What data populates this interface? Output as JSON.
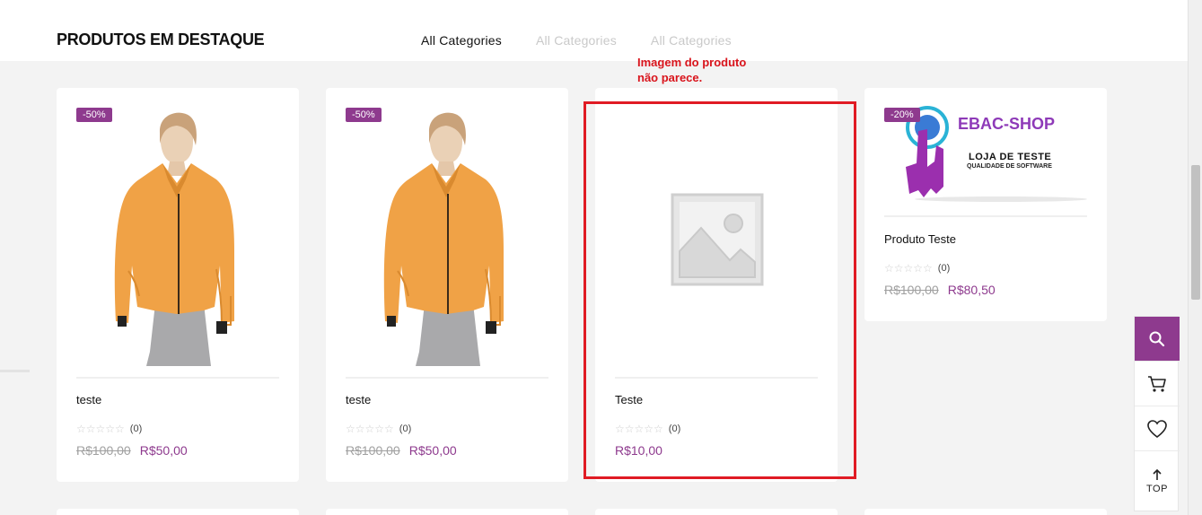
{
  "section": {
    "title": "PRODUTOS EM DESTAQUE"
  },
  "tabs": [
    {
      "label": "All Categories",
      "active": true
    },
    {
      "label": "All Categories",
      "active": false
    },
    {
      "label": "All Categories",
      "active": false
    }
  ],
  "products": [
    {
      "badge": "-50%",
      "name": "teste",
      "rating_count": "(0)",
      "old_price": "R$100,00",
      "price": "R$50,00",
      "image": "orange-jacket-woman"
    },
    {
      "badge": "-50%",
      "name": "teste",
      "rating_count": "(0)",
      "old_price": "R$100,00",
      "price": "R$50,00",
      "image": "orange-jacket-woman"
    },
    {
      "badge": "",
      "name": "Teste",
      "rating_count": "(0)",
      "old_price": "",
      "price": "R$10,00",
      "image": "placeholder-image"
    },
    {
      "badge": "-20%",
      "name": "Produto Teste",
      "rating_count": "(0)",
      "old_price": "R$100,00",
      "price": "R$80,50",
      "image": "ebac-shop-logo",
      "logo": {
        "brand": "EBAC-SHOP",
        "line1": "LOJA DE TESTE",
        "line2": "QUALIDADE DE SOFTWARE"
      }
    }
  ],
  "annotation": {
    "line1": "Imagem do produto",
    "line2": "não parece."
  },
  "side_tools": {
    "top_label": "TOP"
  },
  "colors": {
    "accent": "#8e3a8e",
    "annotation": "#e01b24",
    "background": "#f3f3f3"
  }
}
